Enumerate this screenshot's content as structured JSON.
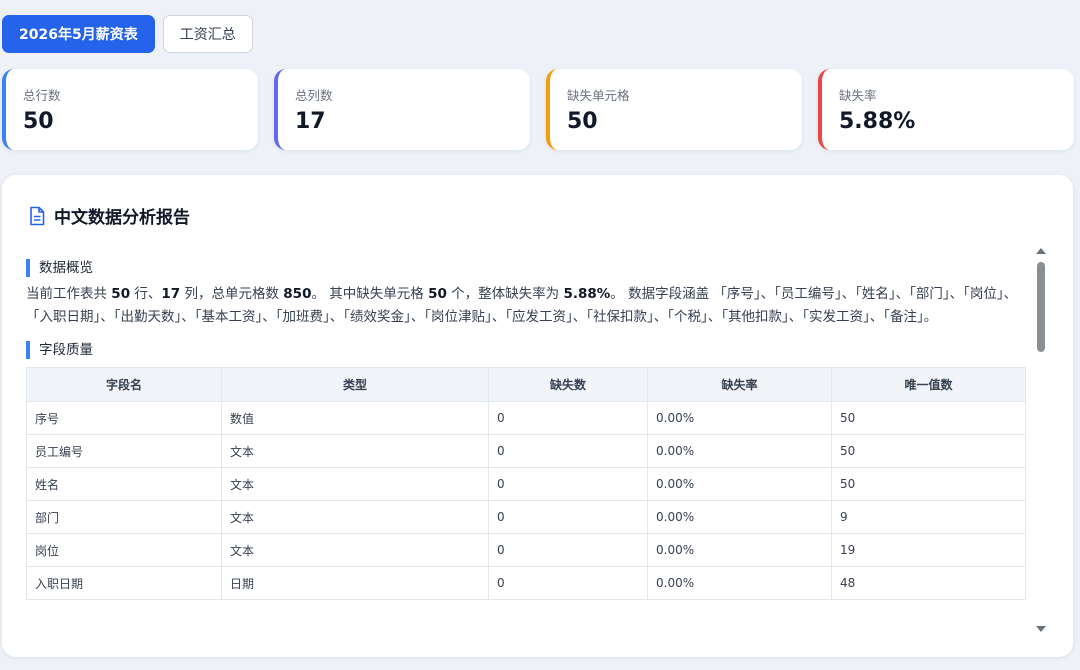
{
  "tabs": [
    {
      "label": "2026年5月薪资表",
      "active": true
    },
    {
      "label": "工资汇总",
      "active": false
    }
  ],
  "stats": [
    {
      "label": "总行数",
      "value": "50",
      "color": "#3b82f6"
    },
    {
      "label": "总列数",
      "value": "17",
      "color": "#6366f1"
    },
    {
      "label": "缺失单元格",
      "value": "50",
      "color": "#f59e0b"
    },
    {
      "label": "缺失率",
      "value": "5.88%",
      "color": "#ef4444"
    }
  ],
  "report": {
    "title": "中文数据分析报告",
    "icon": "document-icon",
    "overview": {
      "heading": "数据概览",
      "segments": [
        {
          "text": "当前工作表共 ",
          "bold": false
        },
        {
          "text": "50",
          "bold": true
        },
        {
          "text": " 行、",
          "bold": false
        },
        {
          "text": "17",
          "bold": true
        },
        {
          "text": " 列，总单元格数 ",
          "bold": false
        },
        {
          "text": "850",
          "bold": true
        },
        {
          "text": "。 其中缺失单元格 ",
          "bold": false
        },
        {
          "text": "50",
          "bold": true
        },
        {
          "text": " 个，整体缺失率为 ",
          "bold": false
        },
        {
          "text": "5.88%",
          "bold": true
        },
        {
          "text": "。 数据字段涵盖 「序号」、「员工编号」、「姓名」、「部门」、「岗位」、「入职日期」、「出勤天数」、「基本工资」、「加班费」、「绩效奖金」、「岗位津贴」、「应发工资」、「社保扣款」、「个税」、「其他扣款」、「实发工资」、「备注」。",
          "bold": false
        }
      ]
    },
    "quality": {
      "heading": "字段质量",
      "columns": [
        "字段名",
        "类型",
        "缺失数",
        "缺失率",
        "唯一值数"
      ],
      "rows": [
        [
          "序号",
          "数值",
          "0",
          "0.00%",
          "50"
        ],
        [
          "员工编号",
          "文本",
          "0",
          "0.00%",
          "50"
        ],
        [
          "姓名",
          "文本",
          "0",
          "0.00%",
          "50"
        ],
        [
          "部门",
          "文本",
          "0",
          "0.00%",
          "9"
        ],
        [
          "岗位",
          "文本",
          "0",
          "0.00%",
          "19"
        ],
        [
          "入职日期",
          "日期",
          "0",
          "0.00%",
          "48"
        ]
      ]
    }
  }
}
